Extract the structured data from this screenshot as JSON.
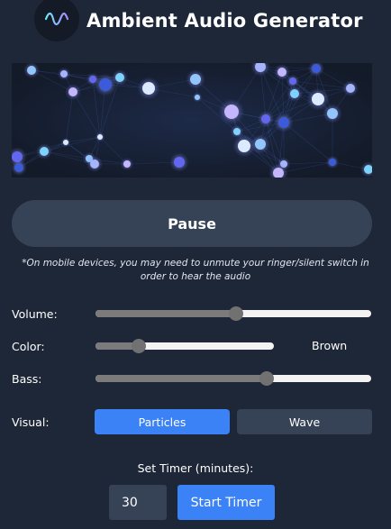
{
  "header": {
    "title": "Ambient Audio Generator",
    "logo_icon": "waveform-icon"
  },
  "visualizer": {
    "style": "particle network"
  },
  "controls": {
    "pause_label": "Pause",
    "mobile_note": "*On mobile devices, you may need to unmute your ringer/silent switch in order to hear the audio",
    "volume": {
      "label": "Volume:",
      "value_fraction": 0.51
    },
    "color": {
      "label": "Color:",
      "value_fraction": 0.24,
      "value_text": "Brown"
    },
    "bass": {
      "label": "Bass:",
      "value_fraction": 0.62
    },
    "visual": {
      "label": "Visual:",
      "options": [
        "Particles",
        "Wave"
      ],
      "selected": "Particles"
    },
    "timer": {
      "label": "Set Timer (minutes):",
      "value": "30",
      "start_label": "Start Timer"
    }
  },
  "colors": {
    "background": "#1e2738",
    "button": "#364357",
    "accent": "#3b82f6",
    "slider_track": "#f3f3f3",
    "slider_fill": "#7b7b7b"
  }
}
